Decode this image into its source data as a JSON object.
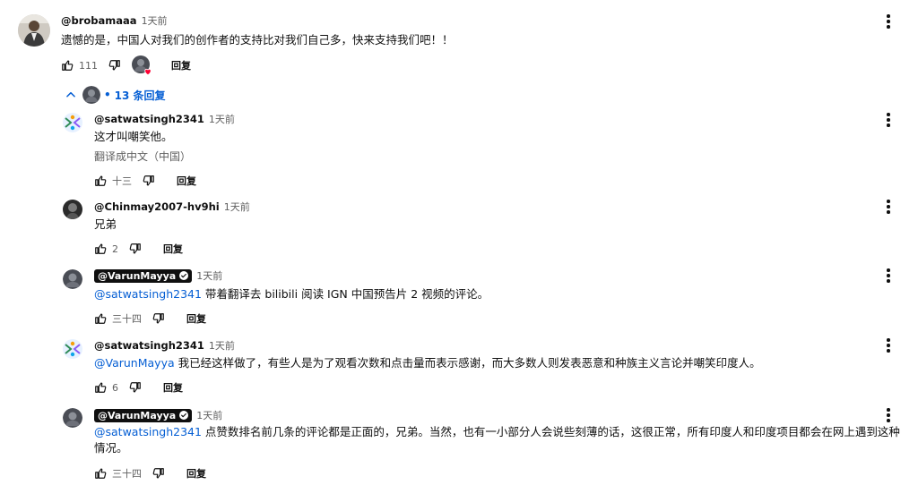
{
  "top_comment": {
    "handle": "@brobamaaa",
    "time": "1天前",
    "text": "遗憾的是，中国人对我们的创作者的支持比对我们自己多，快来支持我们吧！！",
    "likes": "111",
    "reply_label": "回复"
  },
  "replies_toggle": {
    "label": "13 条回复"
  },
  "replies": [
    {
      "handle": "@satwatsingh2341",
      "time": "1天前",
      "text": "这才叫嘲笑他。",
      "translate": "翻译成中文（中国）",
      "likes": "十三",
      "reply_label": "回复"
    },
    {
      "handle": "@Chinmay2007-hv9hi",
      "time": "1天前",
      "text": "兄弟",
      "likes": "2",
      "reply_label": "回复"
    },
    {
      "handle": "@VarunMayya",
      "time": "1天前",
      "mention": "@satwatsingh2341",
      "text": " 带着翻译去 bilibili 阅读 IGN 中国预告片 2 视频的评论。",
      "likes": "三十四",
      "reply_label": "回复"
    },
    {
      "handle": "@satwatsingh2341",
      "time": "1天前",
      "mention": "@VarunMayya",
      "text": " 我已经这样做了，有些人是为了观看次数和点击量而表示感谢，而大多数人则发表恶意和种族主义言论并嘲笑印度人。",
      "likes": "6",
      "reply_label": "回复"
    },
    {
      "handle": "@VarunMayya",
      "time": "1天前",
      "mention": "@satwatsingh2341",
      "text": " 点赞数排名前几条的评论都是正面的，兄弟。当然，也有一小部分人会说些刻薄的话，这很正常，所有印度人和印度项目都会在网上遇到这种情况。",
      "likes": "三十四",
      "reply_label": "回复"
    }
  ],
  "colors": {
    "link_blue": "#065fd4",
    "text": "#0f0f0f",
    "secondary": "#606060",
    "heart": "#ff0033"
  }
}
